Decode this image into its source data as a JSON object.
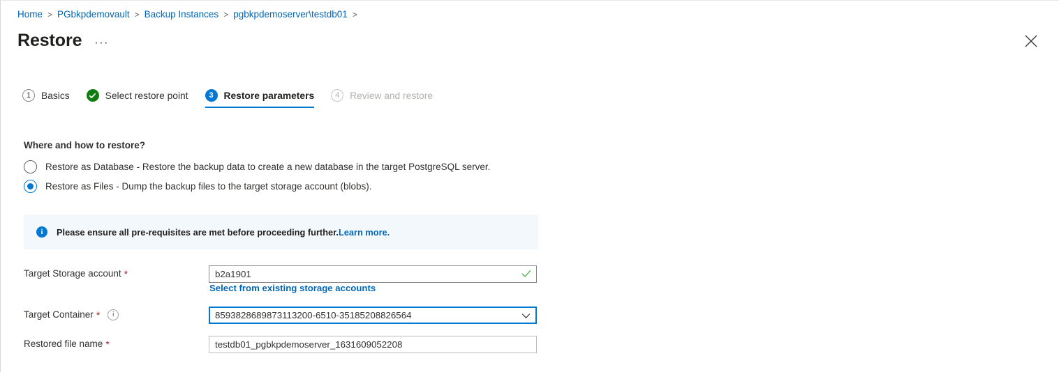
{
  "breadcrumb": {
    "items": [
      {
        "label": "Home"
      },
      {
        "label": "PGbkpdemovault"
      },
      {
        "label": "Backup Instances"
      },
      {
        "label": "pgbkpdemoserver\\testdb01"
      }
    ],
    "separator": ">"
  },
  "header": {
    "title": "Restore",
    "more_label": "···",
    "close_icon": "close-icon"
  },
  "wizard": {
    "steps": [
      {
        "badge": "1",
        "label": "Basics",
        "state": "todo"
      },
      {
        "badge": "✓",
        "label": "Select restore point",
        "state": "done"
      },
      {
        "badge": "3",
        "label": "Restore parameters",
        "state": "active"
      },
      {
        "badge": "4",
        "label": "Review and restore",
        "state": "disabled"
      }
    ]
  },
  "main": {
    "section_heading": "Where and how to restore?",
    "restore_options": [
      {
        "label": "Restore as Database - Restore the backup data to create a new database in the target PostgreSQL server.",
        "checked": false
      },
      {
        "label": "Restore as Files - Dump the backup files to the target storage account (blobs).",
        "checked": true
      }
    ],
    "banner": {
      "icon": "info-icon",
      "text": "Please ensure all pre-requisites are met before proceeding further.",
      "link_text": "Learn more."
    },
    "fields": {
      "storage_account": {
        "label": "Target Storage account",
        "required_mark": "*",
        "value": "b2a1901",
        "placeholder": "",
        "validated": true,
        "sub_link": "Select from existing storage accounts"
      },
      "container": {
        "label": "Target Container",
        "required_mark": "*",
        "info_glyph": "i",
        "value": "8593828689873113200-6510-35185208826564",
        "placeholder": ""
      },
      "file_name": {
        "label": "Restored file name",
        "required_mark": "*",
        "value": "testdb01_pgbkpdemoserver_1631609052208",
        "placeholder": ""
      }
    }
  },
  "colors": {
    "accent": "#0078d4",
    "link": "#0067b8",
    "success": "#107c10",
    "required": "#a4262c",
    "banner_bg": "#f3f8fd"
  }
}
